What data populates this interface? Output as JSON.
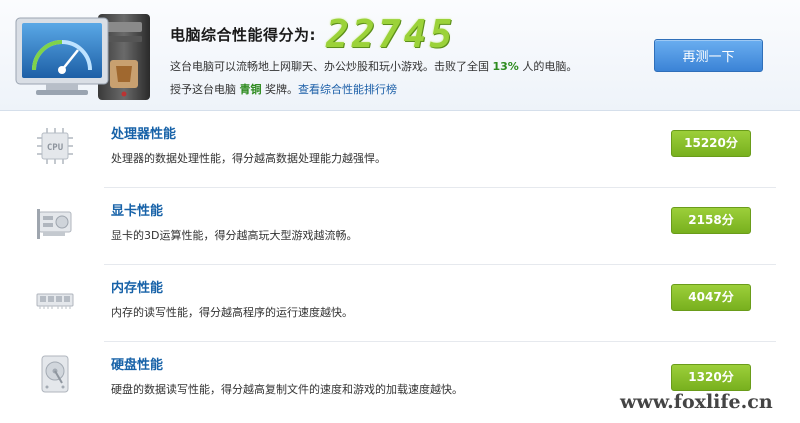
{
  "header": {
    "score_label": "电脑综合性能得分为:",
    "score_value": "22745",
    "desc_before": "这台电脑可以流畅地上网聊天、办公炒股和玩小游戏。击败了全国 ",
    "desc_percent": "13%",
    "desc_after": " 人的电脑。",
    "award_prefix": "授予这台电脑 ",
    "award_medal": "青铜",
    "award_suffix": " 奖牌。",
    "ranking_link": "查看综合性能排行榜",
    "retest_button": "再测一下"
  },
  "rows": [
    {
      "title": "处理器性能",
      "desc": "处理器的数据处理性能，得分越高数据处理能力越强悍。",
      "score": "15220分",
      "icon": "cpu-icon"
    },
    {
      "title": "显卡性能",
      "desc": "显卡的3D运算性能，得分越高玩大型游戏越流畅。",
      "score": "2158分",
      "icon": "graphics-card-icon"
    },
    {
      "title": "内存性能",
      "desc": "内存的读写性能，得分越高程序的运行速度越快。",
      "score": "4047分",
      "icon": "memory-icon"
    },
    {
      "title": "硬盘性能",
      "desc": "硬盘的数据读写性能，得分越高复制文件的速度和游戏的加载速度越快。",
      "score": "1320分",
      "icon": "hard-disk-icon"
    }
  ],
  "watermark": "www.foxlife.cn",
  "colors": {
    "accent_blue": "#1762a8",
    "score_green": "#9bd239",
    "badge_green": "#78b01e",
    "button_blue": "#3b83d6"
  }
}
